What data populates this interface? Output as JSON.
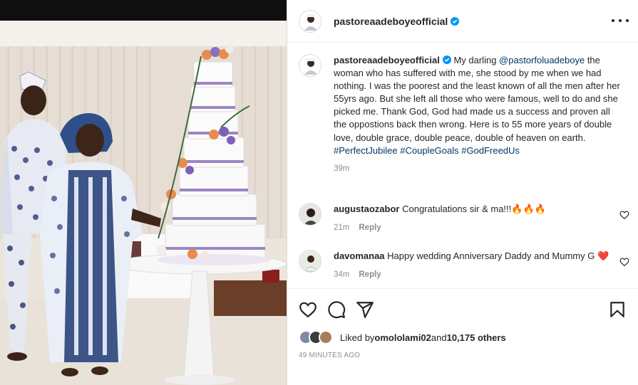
{
  "post": {
    "author": "pastoreaadeboyeofficial",
    "caption": {
      "author": "pastoreaadeboyeofficial",
      "mention": "@pastorfoluadeboye",
      "text_before_mention": "My darling ",
      "text_after_mention": " the woman who has suffered with me, she stood by me when we had nothing. I was the poorest and the least known of all the men after her 55yrs ago. But she left all those who were famous, well to do and she picked me. Thank God, God had made us a success and proven all the oppostions back then wrong. Here is to 55 more years of double love, double grace, double peace, double of heaven on earth. ",
      "hashtags": [
        "#PerfectJubilee",
        "#CoupleGoals",
        "#GodFreedUs"
      ],
      "time": "39m"
    },
    "comments": [
      {
        "author": "augustaozabor",
        "text": "Congratulations sir & ma!!!🔥🔥🔥",
        "time": "21m",
        "reply_label": "Reply"
      },
      {
        "author": "davomanaa",
        "text": "Happy wedding Anniversary Daddy and Mummy G ❤️",
        "time": "34m",
        "reply_label": "Reply"
      }
    ],
    "likes": {
      "prefix": "Liked by ",
      "first_liker": "omololami02",
      "conjunction": " and ",
      "others": "10,175 others"
    },
    "time_ago": "49 MINUTES AGO"
  },
  "icons": {
    "verified": "verified-badge-icon",
    "more": "more-options-icon",
    "like": "heart-icon",
    "comment": "comment-icon",
    "share": "share-icon",
    "save": "bookmark-icon"
  },
  "colors": {
    "verified": "#0095f6",
    "link": "#00376b",
    "muted": "#8e8e8e",
    "heart_red": "#ed4956"
  }
}
